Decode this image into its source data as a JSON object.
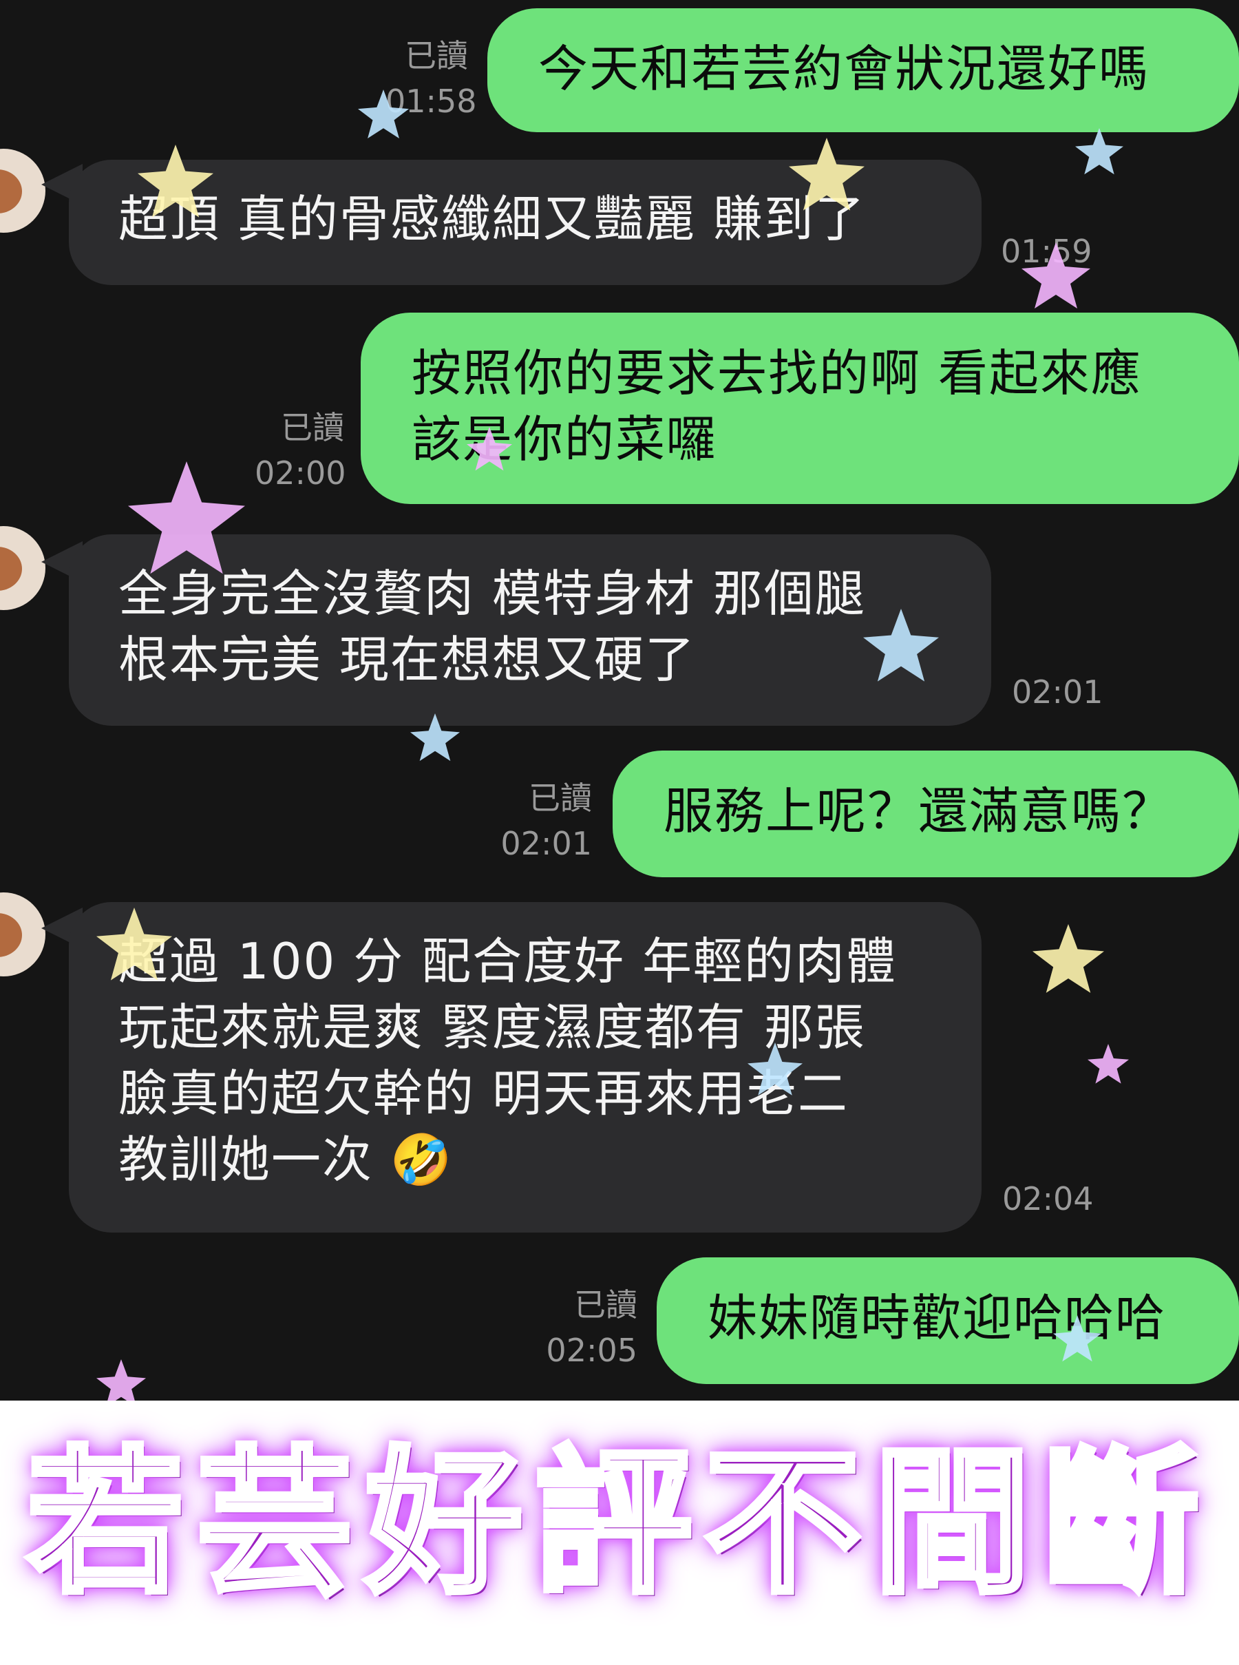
{
  "messages": [
    {
      "side": "sent",
      "text": "今天和若芸約會狀況還好嗎",
      "read": "已讀",
      "time": "01:58"
    },
    {
      "side": "received",
      "text": "超頂 真的骨感纖細又豔麗 賺到了",
      "time": "01:59"
    },
    {
      "side": "sent",
      "text": "按照你的要求去找的啊 看起來應\n該是你的菜囉",
      "read": "已讀",
      "time": "02:00"
    },
    {
      "side": "received",
      "text": "全身完全沒贅肉 模特身材 那個腿\n根本完美 現在想想又硬了",
      "time": "02:01"
    },
    {
      "side": "sent",
      "text": "服務上呢？還滿意嗎？",
      "read": "已讀",
      "time": "02:01"
    },
    {
      "side": "received",
      "text": "超過 100 分 配合度好 年輕的肉體\n玩起來就是爽 緊度濕度都有 那張\n臉真的超欠幹的 明天再來用老二\n教訓她一次 🤣",
      "time": "02:04"
    },
    {
      "side": "sent",
      "text": "妹妹隨時歡迎哈哈哈",
      "read": "已讀",
      "time": "02:05"
    }
  ],
  "banner": {
    "text": "若芸好評不間斷"
  },
  "colors": {
    "chat_background": "#151515",
    "sent_bubble": "#6ee27b",
    "received_bubble": "#2c2c2e",
    "meta_text": "#9a9a9a",
    "banner_text": "#9b1fc0",
    "star_yellow": "#fff6b0",
    "star_blue": "#bfe6ff",
    "star_pink": "#f5b6ff"
  }
}
